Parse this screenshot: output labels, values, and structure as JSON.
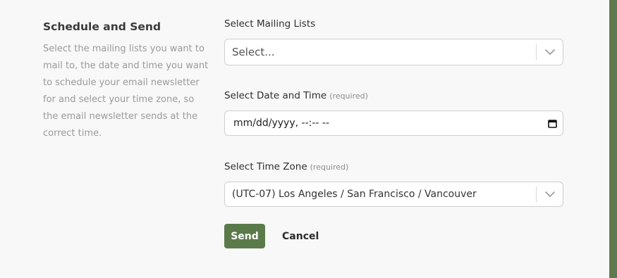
{
  "intro": {
    "title": "Schedule and Send",
    "description": "Select the mailing lists you want to mail to, the date and time you want to schedule your email newsletter for and select your time zone, so the email newsletter sends at the correct time."
  },
  "mailing_lists": {
    "label": "Select Mailing Lists",
    "placeholder": "Select..."
  },
  "date_time": {
    "label": "Select Date and Time",
    "required_note": "(required)",
    "value": "mm/dd/yyyy, --:-- --"
  },
  "time_zone": {
    "label": "Select Time Zone",
    "required_note": "(required)",
    "value": "(UTC-07) Los Angeles / San Francisco / Vancouver"
  },
  "actions": {
    "send_label": "Send",
    "cancel_label": "Cancel"
  },
  "colors": {
    "accent": "#5b7a4a",
    "side_bar": "#5e7a4d",
    "background": "#f8f8f8"
  },
  "icons": {
    "dropdown": "chevron-down-icon",
    "date": "calendar-icon"
  }
}
